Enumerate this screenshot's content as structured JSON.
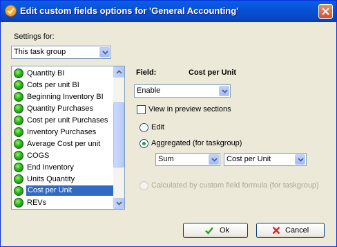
{
  "window": {
    "title": "Edit custom fields options for  'General Accounting'"
  },
  "settings": {
    "label": "Settings for:",
    "scope_value": "This task group"
  },
  "fields": [
    "Quantity BI",
    "Cots per unit BI",
    "Beginning Inventory BI",
    "Quantity Purchases",
    "Cost per unit Purchases",
    "Inventory Purchases",
    "Average Cost per unit",
    "COGS",
    "End Inventory",
    "Units Quantity",
    "Cost per Unit",
    "REVs"
  ],
  "selected_field": "Cost per Unit",
  "detail": {
    "field_label": "Field:",
    "field_name": "Cost per Unit",
    "mode_value": "Enable",
    "view_preview_label": "View in preview sections",
    "view_preview_checked": false,
    "edit_label": "Edit",
    "aggregated_label": "Aggregated (for taskgroup)",
    "aggregated_selected": true,
    "agg_function": "Sum",
    "agg_source": "Cost per Unit",
    "formula_label": "Calculated by custom field formula (for taskgroup)"
  },
  "buttons": {
    "ok": "Ok",
    "cancel": "Cancel"
  }
}
